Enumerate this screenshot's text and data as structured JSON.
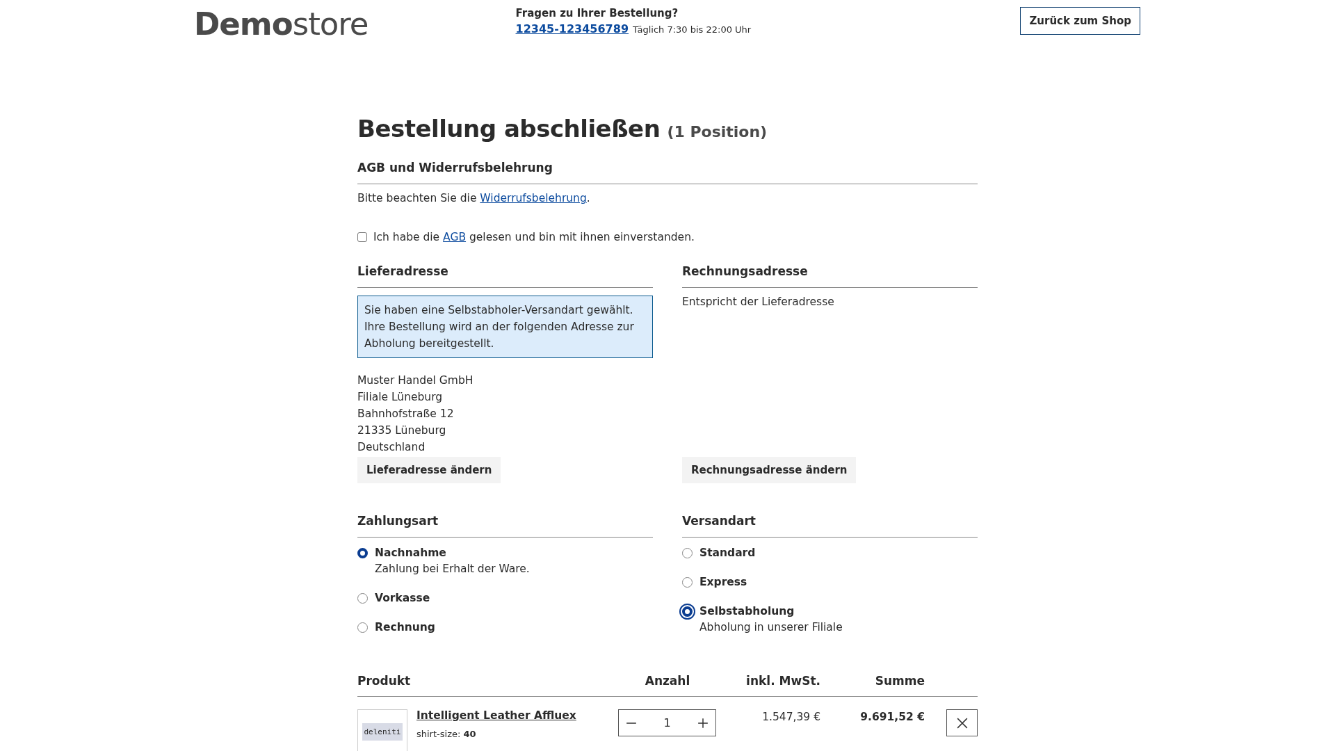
{
  "header": {
    "logo_bold": "Demo",
    "logo_light": "store",
    "contact_title": "Fragen zu Ihrer Bestellung?",
    "phone": "12345-123456789",
    "hours": "Täglich 7:30 bis 22:00 Uhr",
    "back_button": "Zurück zum Shop"
  },
  "page_title": {
    "title": "Bestellung abschließen",
    "count": "(1 Position)"
  },
  "terms": {
    "heading": "AGB und Widerrufsbelehrung",
    "notice_prefix": "Bitte beachten Sie die ",
    "notice_link": "Widerrufsbelehrung",
    "notice_suffix": ".",
    "checkbox": {
      "checked": false,
      "prefix": "Ich habe die ",
      "link": "AGB",
      "suffix": " gelesen und bin mit ihnen einverstanden."
    }
  },
  "delivery": {
    "heading": "Lieferadresse",
    "info": "Sie haben eine Selbstabholer-Versandart gewählt. Ihre Bestellung wird an der folgenden Adresse zur Abholung bereitgestellt.",
    "address": [
      "Muster Handel GmbH",
      "Filiale Lüneburg",
      "Bahnhofstraße 12",
      "21335 Lüneburg",
      "Deutschland"
    ],
    "button": "Lieferadresse ändern"
  },
  "billing": {
    "heading": "Rechnungsadresse",
    "text": "Entspricht der Lieferadresse",
    "button": "Rechnungsadresse ändern"
  },
  "payment": {
    "heading": "Zahlungsart",
    "options": [
      {
        "label": "Nachnahme",
        "description": "Zahlung bei Erhalt der Ware.",
        "selected": true,
        "focused": false
      },
      {
        "label": "Vorkasse",
        "selected": false,
        "focused": false
      },
      {
        "label": "Rechnung",
        "selected": false,
        "focused": false
      }
    ]
  },
  "shipping": {
    "heading": "Versandart",
    "options": [
      {
        "label": "Standard",
        "selected": false,
        "focused": false
      },
      {
        "label": "Express",
        "selected": false,
        "focused": false
      },
      {
        "label": "Selbstabholung",
        "description": "Abholung in unserer Filiale",
        "selected": true,
        "focused": true
      }
    ]
  },
  "table": {
    "columns": [
      "Produkt",
      "Anzahl",
      "inkl. MwSt.",
      "Summe"
    ],
    "rows": [
      {
        "image_text": "deleniti",
        "name": "Intelligent Leather Affluex",
        "option_label": "shirt-size:",
        "option_value": "40",
        "quantity": "1",
        "unit_price": "1.547,39 €",
        "total": "9.691,52 €"
      }
    ]
  }
}
